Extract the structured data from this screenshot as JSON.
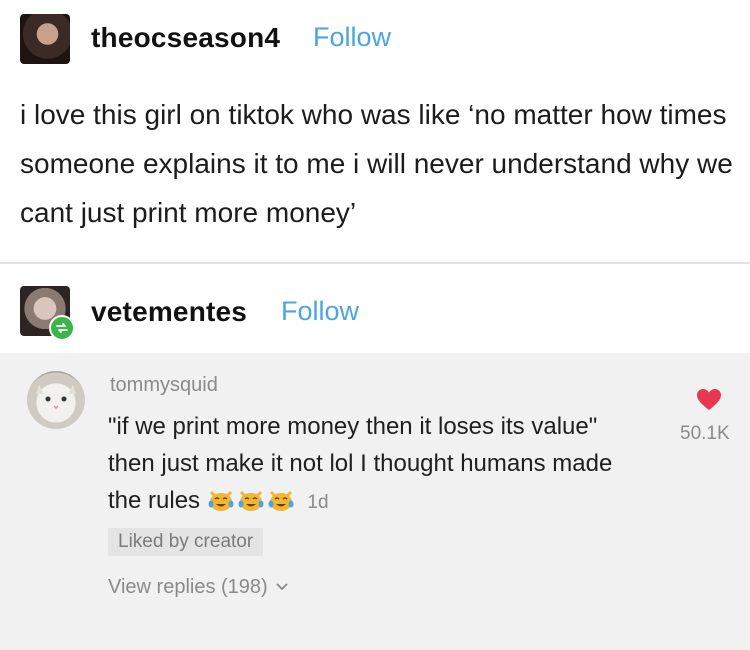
{
  "post": {
    "username": "theocseason4",
    "follow_label": "Follow",
    "body": "i love this girl on tiktok who was like ‘no matter how times someone explains it to me i will never understand why we cant just print more money’"
  },
  "reblog": {
    "username": "vetementes",
    "follow_label": "Follow"
  },
  "tiktok_comment": {
    "username": "tommysquid",
    "text": "\"if we print more money then it loses its value\" then just make it not lol I thought humans made the rules",
    "emoji": [
      "crying-laughing-cat",
      "crying-laughing-cat",
      "crying-laughing-cat"
    ],
    "time": "1d",
    "liked_badge": "Liked by creator",
    "view_replies": "View replies (198)",
    "like_count": "50.1K"
  },
  "colors": {
    "follow": "#4aa6dc",
    "heart": "#e8384f",
    "reblog_badge": "#3bb54a",
    "card_background": "#f1f1f1"
  }
}
